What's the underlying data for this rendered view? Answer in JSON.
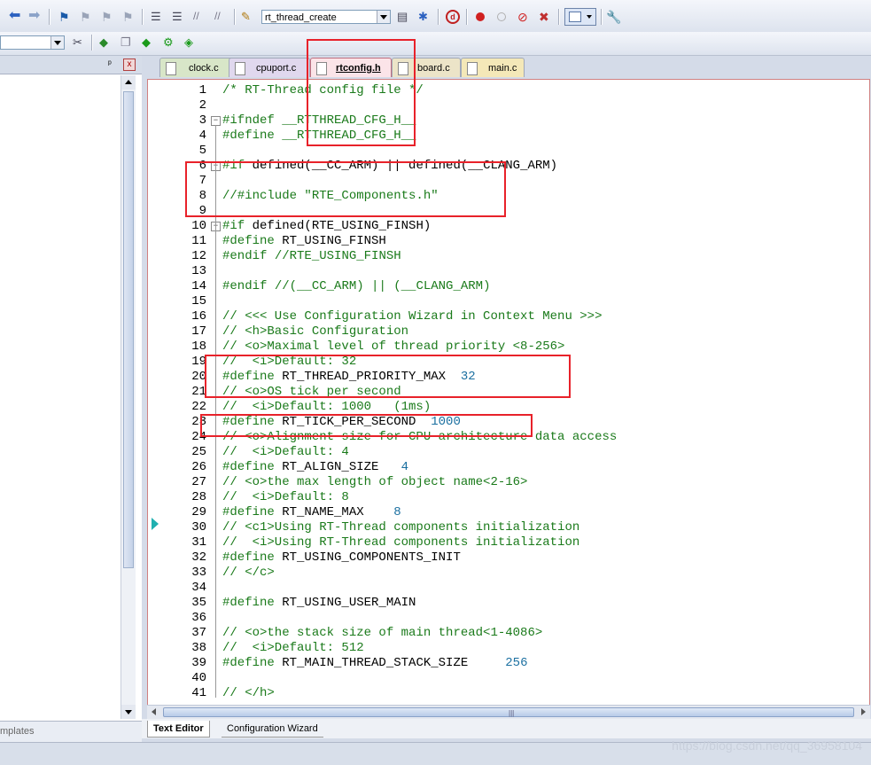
{
  "toolbar": {
    "target_combo_value": "rt_thread_create",
    "icons": [
      "back-arrow-icon",
      "forward-arrow-icon",
      "bookmark-icon",
      "bookmark-prev-icon",
      "bookmark-next-icon",
      "bookmark-clear-icon",
      "indent-icon",
      "unindent-icon",
      "comment-icon",
      "uncomment-icon",
      "find-in-files-icon",
      "find-icon",
      "incremental-find-icon",
      "debug-start-icon",
      "breakpoint-insert-icon",
      "breakpoint-disable-icon",
      "breakpoint-kill-icon",
      "window-layout-icon",
      "settings-wrench-icon"
    ]
  },
  "toolbar2": {
    "icons": [
      "options-icon",
      "manage-components-icon",
      "stack-icon",
      "green-diamond-icon",
      "gear-diamond-icon",
      "run-time-environment-icon"
    ]
  },
  "left_panel": {
    "pin_label": "ᵖ",
    "close_label": "x",
    "bottom_tab": "mplates"
  },
  "tabs": [
    {
      "label": "clock.c",
      "active": false
    },
    {
      "label": "cpuport.c",
      "active": false
    },
    {
      "label": "rtconfig.h",
      "active": true
    },
    {
      "label": "board.c",
      "active": false
    },
    {
      "label": "main.c",
      "active": false
    }
  ],
  "editor": {
    "lines": [
      {
        "n": "1",
        "html": "<span class='cm'>/* RT-Thread config file */</span>"
      },
      {
        "n": "2",
        "html": ""
      },
      {
        "n": "3",
        "html": "<span class='pp'>#ifndef __RTTHREAD_CFG_H__</span>",
        "fold": true
      },
      {
        "n": "4",
        "html": "<span class='pp'>#define __RTTHREAD_CFG_H__</span>"
      },
      {
        "n": "5",
        "html": ""
      },
      {
        "n": "6",
        "html": "<span class='pp'>#if</span> defined(__CC_ARM) || defined(__CLANG_ARM)",
        "fold": true
      },
      {
        "n": "7",
        "html": ""
      },
      {
        "n": "8",
        "html": "<span class='cm'>//#include \"RTE_Components.h\"</span>"
      },
      {
        "n": "9",
        "html": ""
      },
      {
        "n": "10",
        "html": "<span class='pp'>#if</span> defined(RTE_USING_FINSH)",
        "fold": true
      },
      {
        "n": "11",
        "html": "<span class='pp'>#define</span> RT_USING_FINSH"
      },
      {
        "n": "12",
        "html": "<span class='pp'>#endif</span> <span class='cm'>//RTE_USING_FINSH</span>"
      },
      {
        "n": "13",
        "html": ""
      },
      {
        "n": "14",
        "html": "<span class='pp'>#endif</span> <span class='cm'>//(__CC_ARM) || (__CLANG_ARM)</span>"
      },
      {
        "n": "15",
        "html": ""
      },
      {
        "n": "16",
        "html": "<span class='cm'>// &lt;&lt;&lt; Use Configuration Wizard in Context Menu &gt;&gt;&gt;</span>"
      },
      {
        "n": "17",
        "html": "<span class='cm'>// &lt;h&gt;Basic Configuration</span>"
      },
      {
        "n": "18",
        "html": "<span class='cm'>// &lt;o&gt;Maximal level of thread priority &lt;8-256&gt;</span>"
      },
      {
        "n": "19",
        "html": "<span class='cm'>//  &lt;i&gt;Default: 32</span>"
      },
      {
        "n": "20",
        "html": "<span class='pp'>#define</span> RT_THREAD_PRIORITY_MAX  <span class='num'>32</span>"
      },
      {
        "n": "21",
        "html": "<span class='cm'>// &lt;o&gt;OS tick per second</span>"
      },
      {
        "n": "22",
        "html": "<span class='cm'>//  &lt;i&gt;Default: 1000   (1ms)</span>"
      },
      {
        "n": "23",
        "html": "<span class='pp'>#define</span> RT_TICK_PER_SECOND  <span class='num'>1000</span>"
      },
      {
        "n": "24",
        "html": "<span class='cm'>// &lt;o&gt;Alignment size for CPU architecture data access</span>"
      },
      {
        "n": "25",
        "html": "<span class='cm'>//  &lt;i&gt;Default: 4</span>"
      },
      {
        "n": "26",
        "html": "<span class='pp'>#define</span> RT_ALIGN_SIZE   <span class='num'>4</span>"
      },
      {
        "n": "27",
        "html": "<span class='cm'>// &lt;o&gt;the max length of object name&lt;2-16&gt;</span>"
      },
      {
        "n": "28",
        "html": "<span class='cm'>//  &lt;i&gt;Default: 8</span>"
      },
      {
        "n": "29",
        "html": "<span class='pp'>#define</span> RT_NAME_MAX    <span class='num'>8</span>"
      },
      {
        "n": "30",
        "html": "<span class='cm'>// &lt;c1&gt;Using RT-Thread components initialization</span>"
      },
      {
        "n": "31",
        "html": "<span class='cm'>//  &lt;i&gt;Using RT-Thread components initialization</span>"
      },
      {
        "n": "32",
        "html": "<span class='pp'>#define</span> RT_USING_COMPONENTS_INIT"
      },
      {
        "n": "33",
        "html": "<span class='cm'>// &lt;/c&gt;</span>"
      },
      {
        "n": "34",
        "html": ""
      },
      {
        "n": "35",
        "html": "<span class='pp'>#define</span> RT_USING_USER_MAIN"
      },
      {
        "n": "36",
        "html": ""
      },
      {
        "n": "37",
        "html": "<span class='cm'>// &lt;o&gt;the stack size of main thread&lt;1-4086&gt;</span>"
      },
      {
        "n": "38",
        "html": "<span class='cm'>//  &lt;i&gt;Default: 512</span>"
      },
      {
        "n": "39",
        "html": "<span class='pp'>#define</span> RT_MAIN_THREAD_STACK_SIZE     <span class='num'>256</span>"
      },
      {
        "n": "40",
        "html": ""
      },
      {
        "n": "41",
        "html": "<span class='cm'>// &lt;/h&gt;</span>"
      }
    ]
  },
  "bottom_tabs": [
    {
      "label": "Text Editor",
      "active": true
    },
    {
      "label": "Configuration Wizard",
      "active": false
    }
  ],
  "watermark": "https://blog.csdn.net/qq_36958104",
  "colors": {
    "accent_red": "#e8222a",
    "comment_green": "#1a7a1a",
    "number_blue": "#1a6fa0",
    "active_tab": "#fbe4e8"
  }
}
